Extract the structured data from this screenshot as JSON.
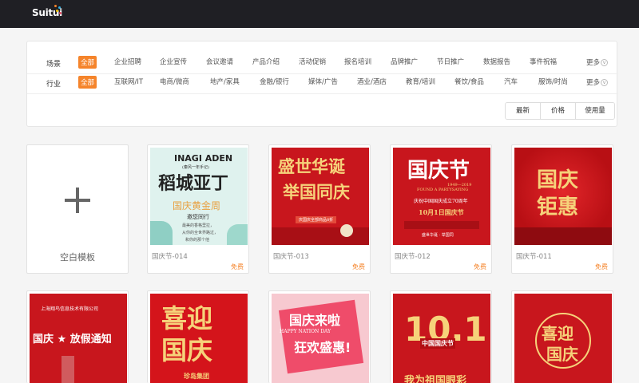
{
  "header": {
    "logo_text": "Suitui"
  },
  "filters": {
    "scene": {
      "label": "场景",
      "active": "全部",
      "items": [
        "企业招聘",
        "企业宣传",
        "会议邀请",
        "产品介绍",
        "活动促销",
        "报名培训",
        "品牌推广",
        "节日推广",
        "数据报告",
        "事件祝福"
      ],
      "more": "更多"
    },
    "industry": {
      "label": "行业",
      "active": "全部",
      "items": [
        "互联网/IT",
        "电商/微商",
        "地产/家具",
        "金融/银行",
        "媒体/广告",
        "酒业/酒店",
        "教育/培训",
        "餐饮/食品",
        "汽车",
        "服饰/时尚"
      ],
      "more": "更多"
    }
  },
  "sort": {
    "latest": "最新",
    "price": "价格",
    "usage": "使用量"
  },
  "blank_template": {
    "label": "空白模板"
  },
  "templates": [
    {
      "name": "国庆节-014",
      "badge": "免费",
      "thumb_lines": [
        "INAGI ADEN",
        "(秦风一年手记)",
        "稻城亚丁",
        "国庆黄金周",
        "邀您同行",
        "最美的香格里拉，",
        "从你的全世界路过，",
        "和你的那个他"
      ]
    },
    {
      "name": "国庆节-013",
      "badge": "免费",
      "thumb_lines": [
        "盛世华诞",
        "举国同庆",
        "庆国庆全部商品8折"
      ]
    },
    {
      "name": "国庆节-012",
      "badge": "免费",
      "thumb_lines": [
        "国庆节",
        "FOUND A PARTYSAYING",
        "1949—2019",
        "庆祝中国国庆成立70周年",
        "10月1日国庆节",
        "盛世华诞 · 举国同"
      ]
    },
    {
      "name": "国庆节-011",
      "badge": "免费",
      "thumb_lines": [
        "国庆",
        "钜惠"
      ]
    },
    {
      "name": "",
      "badge": "",
      "thumb_lines": [
        "上海翔鸟信息技术有限公司",
        "国庆 ★ 放假通知"
      ]
    },
    {
      "name": "",
      "badge": "",
      "thumb_lines": [
        "喜迎",
        "国庆",
        "珍岛集团"
      ]
    },
    {
      "name": "",
      "badge": "",
      "thumb_lines": [
        "国庆来啦",
        "狂欢盛惠!",
        "HAPPY NATION DAY"
      ]
    },
    {
      "name": "",
      "badge": "",
      "thumb_lines": [
        "10.1",
        "中国国庆节",
        "我为祖国眼彩"
      ]
    },
    {
      "name": "",
      "badge": "",
      "thumb_lines": [
        "喜迎",
        "国庆"
      ]
    }
  ],
  "colors": {
    "accent": "#f5842b",
    "topbar": "#1f1f24",
    "festive_red": "#c8161d"
  }
}
